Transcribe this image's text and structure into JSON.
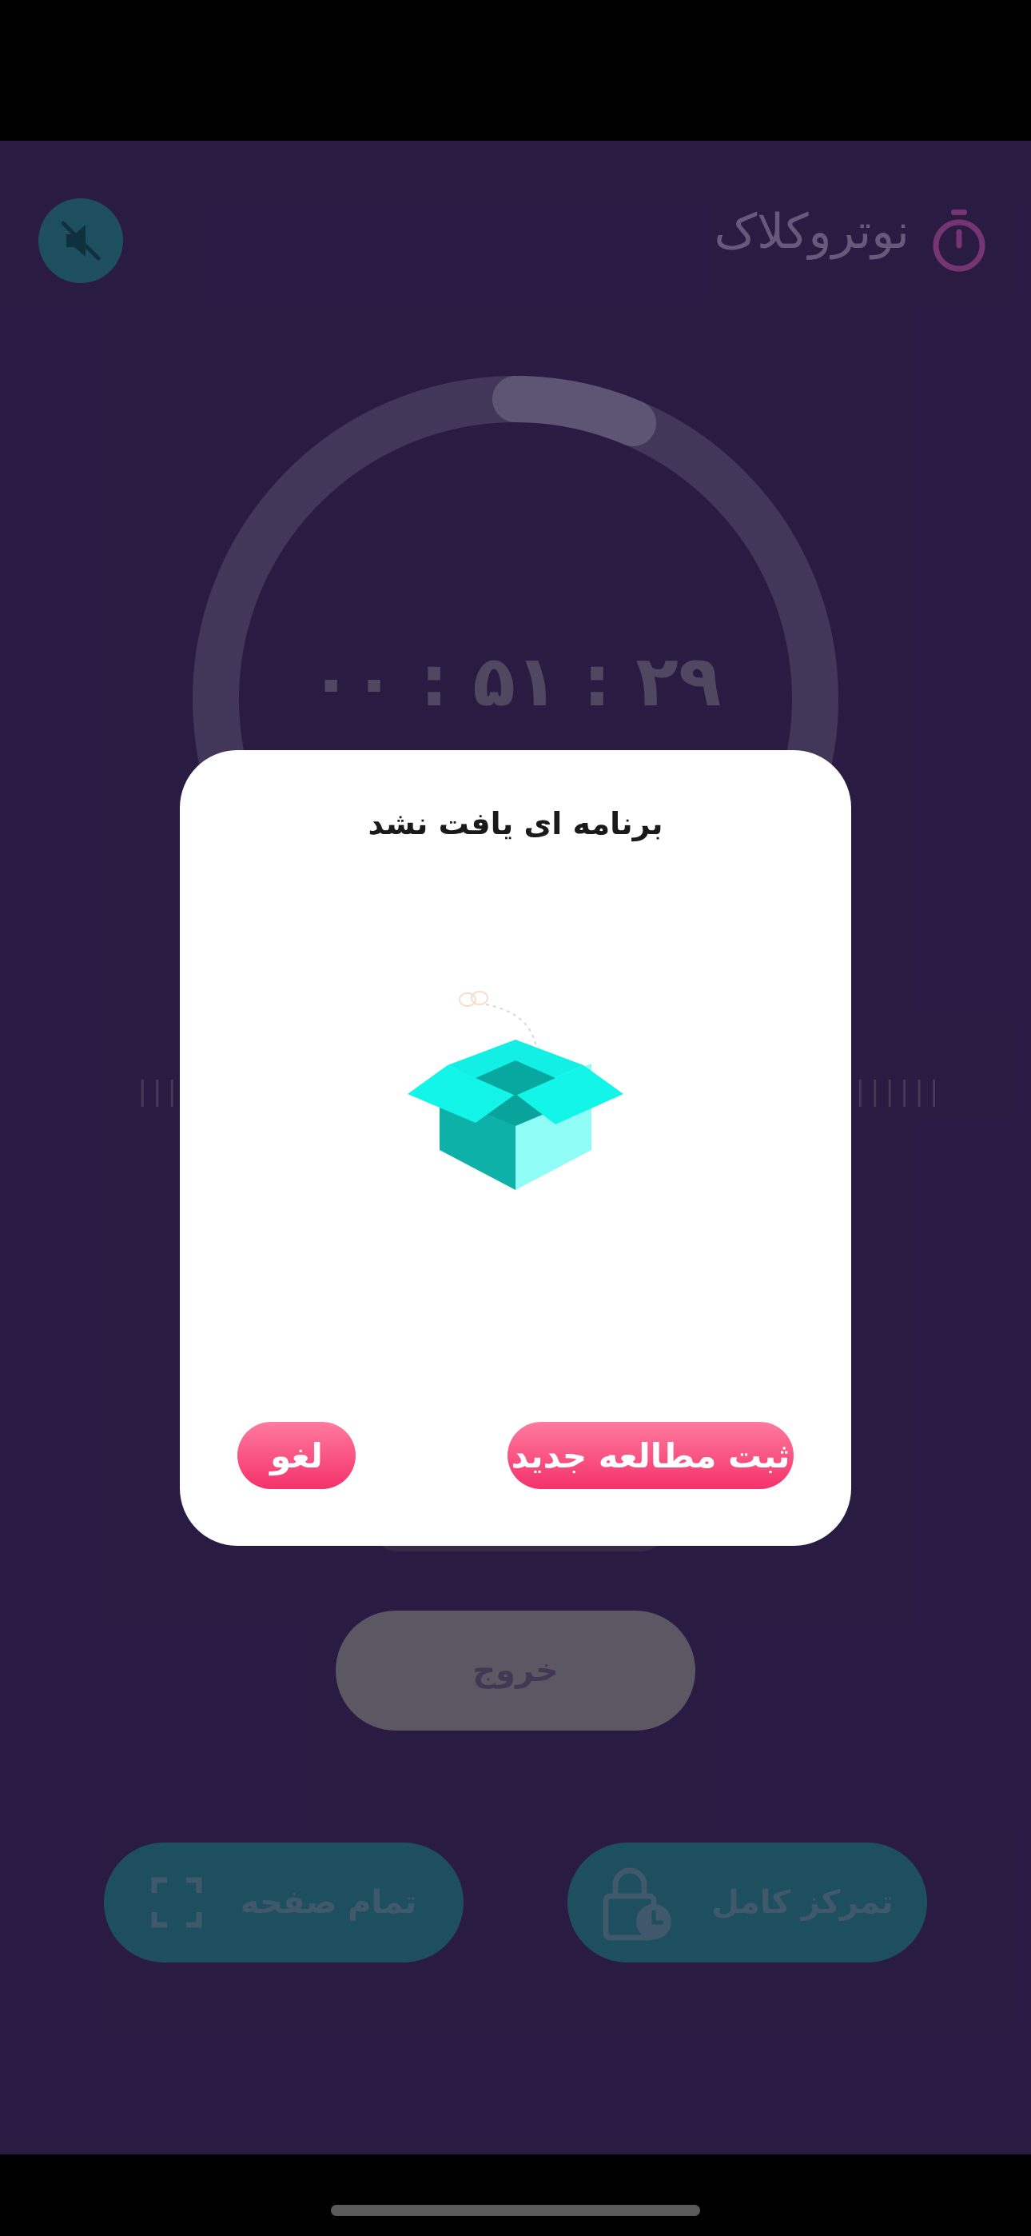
{
  "app": {
    "title": "نوتروکلاک"
  },
  "timer": {
    "display": "۰۰ : ۵۱ : ۲۹"
  },
  "ticks": {
    "left": "||||||",
    "right": "||||||"
  },
  "buttons": {
    "exit": "خروج",
    "fullscreen": "تمام صفحه",
    "full_focus": "تمرکز کامل"
  },
  "dialog": {
    "title": "برنامه ای یافت نشد",
    "cancel": "لغو",
    "new_study": "ثبت مطالعه جدید"
  },
  "colors": {
    "background": "#2f1f4b",
    "accent_pink": "#f4326b",
    "teal_button": "#1f5f6d",
    "box_cyan": "#13f5e8"
  }
}
